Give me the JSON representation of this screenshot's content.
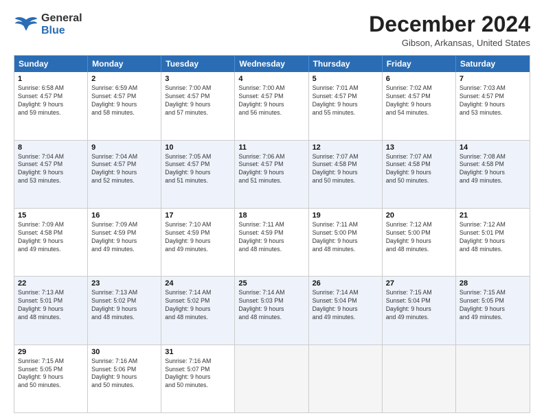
{
  "header": {
    "logo_general": "General",
    "logo_blue": "Blue",
    "month_title": "December 2024",
    "location": "Gibson, Arkansas, United States"
  },
  "weekdays": [
    "Sunday",
    "Monday",
    "Tuesday",
    "Wednesday",
    "Thursday",
    "Friday",
    "Saturday"
  ],
  "weeks": [
    [
      {
        "day": "1",
        "lines": [
          "Sunrise: 6:58 AM",
          "Sunset: 4:57 PM",
          "Daylight: 9 hours",
          "and 59 minutes."
        ]
      },
      {
        "day": "2",
        "lines": [
          "Sunrise: 6:59 AM",
          "Sunset: 4:57 PM",
          "Daylight: 9 hours",
          "and 58 minutes."
        ]
      },
      {
        "day": "3",
        "lines": [
          "Sunrise: 7:00 AM",
          "Sunset: 4:57 PM",
          "Daylight: 9 hours",
          "and 57 minutes."
        ]
      },
      {
        "day": "4",
        "lines": [
          "Sunrise: 7:00 AM",
          "Sunset: 4:57 PM",
          "Daylight: 9 hours",
          "and 56 minutes."
        ]
      },
      {
        "day": "5",
        "lines": [
          "Sunrise: 7:01 AM",
          "Sunset: 4:57 PM",
          "Daylight: 9 hours",
          "and 55 minutes."
        ]
      },
      {
        "day": "6",
        "lines": [
          "Sunrise: 7:02 AM",
          "Sunset: 4:57 PM",
          "Daylight: 9 hours",
          "and 54 minutes."
        ]
      },
      {
        "day": "7",
        "lines": [
          "Sunrise: 7:03 AM",
          "Sunset: 4:57 PM",
          "Daylight: 9 hours",
          "and 53 minutes."
        ]
      }
    ],
    [
      {
        "day": "8",
        "lines": [
          "Sunrise: 7:04 AM",
          "Sunset: 4:57 PM",
          "Daylight: 9 hours",
          "and 53 minutes."
        ]
      },
      {
        "day": "9",
        "lines": [
          "Sunrise: 7:04 AM",
          "Sunset: 4:57 PM",
          "Daylight: 9 hours",
          "and 52 minutes."
        ]
      },
      {
        "day": "10",
        "lines": [
          "Sunrise: 7:05 AM",
          "Sunset: 4:57 PM",
          "Daylight: 9 hours",
          "and 51 minutes."
        ]
      },
      {
        "day": "11",
        "lines": [
          "Sunrise: 7:06 AM",
          "Sunset: 4:57 PM",
          "Daylight: 9 hours",
          "and 51 minutes."
        ]
      },
      {
        "day": "12",
        "lines": [
          "Sunrise: 7:07 AM",
          "Sunset: 4:58 PM",
          "Daylight: 9 hours",
          "and 50 minutes."
        ]
      },
      {
        "day": "13",
        "lines": [
          "Sunrise: 7:07 AM",
          "Sunset: 4:58 PM",
          "Daylight: 9 hours",
          "and 50 minutes."
        ]
      },
      {
        "day": "14",
        "lines": [
          "Sunrise: 7:08 AM",
          "Sunset: 4:58 PM",
          "Daylight: 9 hours",
          "and 49 minutes."
        ]
      }
    ],
    [
      {
        "day": "15",
        "lines": [
          "Sunrise: 7:09 AM",
          "Sunset: 4:58 PM",
          "Daylight: 9 hours",
          "and 49 minutes."
        ]
      },
      {
        "day": "16",
        "lines": [
          "Sunrise: 7:09 AM",
          "Sunset: 4:59 PM",
          "Daylight: 9 hours",
          "and 49 minutes."
        ]
      },
      {
        "day": "17",
        "lines": [
          "Sunrise: 7:10 AM",
          "Sunset: 4:59 PM",
          "Daylight: 9 hours",
          "and 49 minutes."
        ]
      },
      {
        "day": "18",
        "lines": [
          "Sunrise: 7:11 AM",
          "Sunset: 4:59 PM",
          "Daylight: 9 hours",
          "and 48 minutes."
        ]
      },
      {
        "day": "19",
        "lines": [
          "Sunrise: 7:11 AM",
          "Sunset: 5:00 PM",
          "Daylight: 9 hours",
          "and 48 minutes."
        ]
      },
      {
        "day": "20",
        "lines": [
          "Sunrise: 7:12 AM",
          "Sunset: 5:00 PM",
          "Daylight: 9 hours",
          "and 48 minutes."
        ]
      },
      {
        "day": "21",
        "lines": [
          "Sunrise: 7:12 AM",
          "Sunset: 5:01 PM",
          "Daylight: 9 hours",
          "and 48 minutes."
        ]
      }
    ],
    [
      {
        "day": "22",
        "lines": [
          "Sunrise: 7:13 AM",
          "Sunset: 5:01 PM",
          "Daylight: 9 hours",
          "and 48 minutes."
        ]
      },
      {
        "day": "23",
        "lines": [
          "Sunrise: 7:13 AM",
          "Sunset: 5:02 PM",
          "Daylight: 9 hours",
          "and 48 minutes."
        ]
      },
      {
        "day": "24",
        "lines": [
          "Sunrise: 7:14 AM",
          "Sunset: 5:02 PM",
          "Daylight: 9 hours",
          "and 48 minutes."
        ]
      },
      {
        "day": "25",
        "lines": [
          "Sunrise: 7:14 AM",
          "Sunset: 5:03 PM",
          "Daylight: 9 hours",
          "and 48 minutes."
        ]
      },
      {
        "day": "26",
        "lines": [
          "Sunrise: 7:14 AM",
          "Sunset: 5:04 PM",
          "Daylight: 9 hours",
          "and 49 minutes."
        ]
      },
      {
        "day": "27",
        "lines": [
          "Sunrise: 7:15 AM",
          "Sunset: 5:04 PM",
          "Daylight: 9 hours",
          "and 49 minutes."
        ]
      },
      {
        "day": "28",
        "lines": [
          "Sunrise: 7:15 AM",
          "Sunset: 5:05 PM",
          "Daylight: 9 hours",
          "and 49 minutes."
        ]
      }
    ],
    [
      {
        "day": "29",
        "lines": [
          "Sunrise: 7:15 AM",
          "Sunset: 5:05 PM",
          "Daylight: 9 hours",
          "and 50 minutes."
        ]
      },
      {
        "day": "30",
        "lines": [
          "Sunrise: 7:16 AM",
          "Sunset: 5:06 PM",
          "Daylight: 9 hours",
          "and 50 minutes."
        ]
      },
      {
        "day": "31",
        "lines": [
          "Sunrise: 7:16 AM",
          "Sunset: 5:07 PM",
          "Daylight: 9 hours",
          "and 50 minutes."
        ]
      },
      null,
      null,
      null,
      null
    ]
  ]
}
